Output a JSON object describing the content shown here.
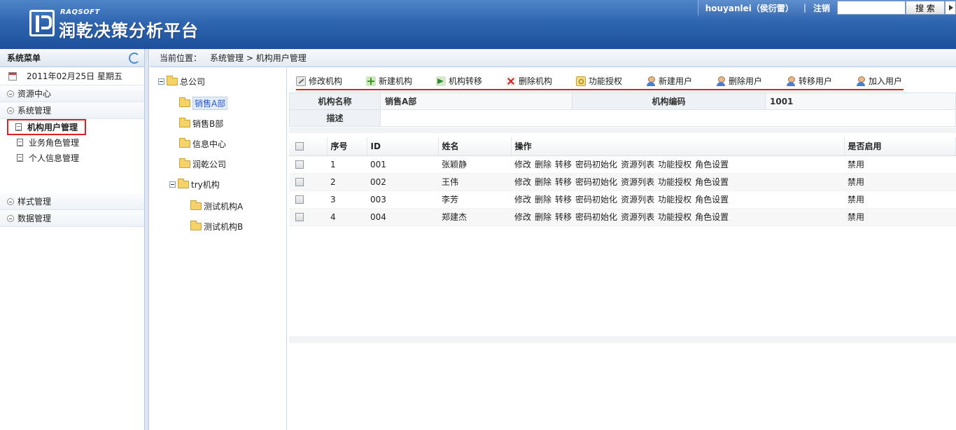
{
  "header": {
    "brand": "RAQSOFT",
    "title": "润乾决策分析平台",
    "user": "houyanlei（侯衍雷）",
    "separator": "|",
    "logout": "注销",
    "search_placeholder": "",
    "search_button": "搜 索"
  },
  "menu": {
    "title": "系统菜单",
    "date": "2011年02月25日 星期五",
    "groups": {
      "resource": "资源中心",
      "system": "系统管理",
      "style": "样式管理",
      "data": "数据管理"
    },
    "items": {
      "org_user": "机构用户管理",
      "role": "业务角色管理",
      "personal": "个人信息管理"
    }
  },
  "breadcrumb": {
    "label": "当前位置：",
    "path": "系统管理 > 机构用户管理"
  },
  "tree": {
    "root": "总公司",
    "sales_a": "销售A部",
    "sales_b": "销售B部",
    "info": "信息中心",
    "runqian": "润乾公司",
    "try": "try机构",
    "test_a": "测试机构A",
    "test_b": "测试机构B"
  },
  "toolbar": {
    "edit_org": "修改机构",
    "new_org": "新建机构",
    "move_org": "机构转移",
    "delete_org": "删除机构",
    "grant": "功能授权",
    "new_user": "新建用户",
    "delete_user": "删除用户",
    "move_user": "转移用户",
    "add_user": "加入用户"
  },
  "org_info": {
    "name_label": "机构名称",
    "name_value": "销售A部",
    "code_label": "机构编码",
    "code_value": "1001",
    "desc_label": "描述",
    "desc_value": ""
  },
  "grid": {
    "headers": {
      "seq": "序号",
      "id": "ID",
      "name": "姓名",
      "ops": "操作",
      "enabled": "是否启用"
    },
    "ops": {
      "edit": "修改",
      "delete": "删除",
      "move": "转移",
      "reset": "密码初始化",
      "resources": "资源列表",
      "grant": "功能授权",
      "roles": "角色设置"
    },
    "rows": [
      {
        "seq": "1",
        "id": "001",
        "name": "张颖静",
        "enabled": "禁用"
      },
      {
        "seq": "2",
        "id": "002",
        "name": "王伟",
        "enabled": "禁用"
      },
      {
        "seq": "3",
        "id": "003",
        "name": "李芳",
        "enabled": "禁用"
      },
      {
        "seq": "4",
        "id": "004",
        "name": "郑建杰",
        "enabled": "禁用"
      }
    ]
  }
}
